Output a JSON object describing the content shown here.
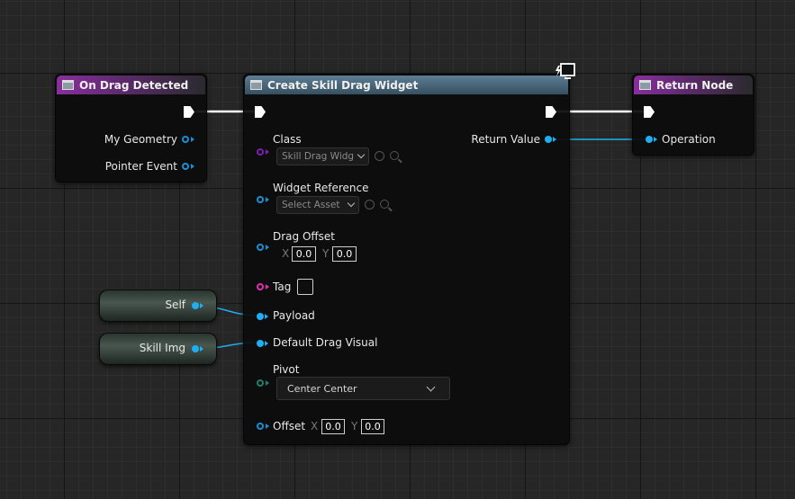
{
  "nodes": {
    "on_drag_detected": {
      "title": "On Drag Detected",
      "pins": [
        "My Geometry",
        "Pointer Event"
      ]
    },
    "create_widget": {
      "title": "Create Skill Drag Widget",
      "class_label": "Class",
      "class_value": "Skill Drag Widg",
      "widget_ref_label": "Widget Reference",
      "widget_ref_value": "Select Asset",
      "drag_offset_label": "Drag Offset",
      "drag_offset_x_axis": "X",
      "drag_offset_x": "0.0",
      "drag_offset_y_axis": "Y",
      "drag_offset_y": "0.0",
      "tag_label": "Tag",
      "payload_label": "Payload",
      "default_drag_visual_label": "Default Drag Visual",
      "pivot_label": "Pivot",
      "pivot_value": "Center Center",
      "offset_label": "Offset",
      "offset_x_axis": "X",
      "offset_x": "0.0",
      "offset_y_axis": "Y",
      "offset_y": "0.0",
      "return_value_label": "Return Value"
    },
    "return_node": {
      "title": "Return Node",
      "operation_label": "Operation"
    },
    "self_var": {
      "label": "Self"
    },
    "skill_img_var": {
      "label": "Skill Img"
    }
  },
  "colors": {
    "object_pin": "#1eaff2",
    "class_pin": "#7a1fb0",
    "string_pin": "#e22fb0",
    "struct_pin": "#1f7f6e",
    "event_header": "#8a2e9e",
    "function_header": "#5d7d94"
  },
  "icons": [
    "node-function-icon",
    "network-replication-icon",
    "exec-pin-icon",
    "reset-arrow-icon",
    "browse-search-icon",
    "chevron-down-icon"
  ]
}
